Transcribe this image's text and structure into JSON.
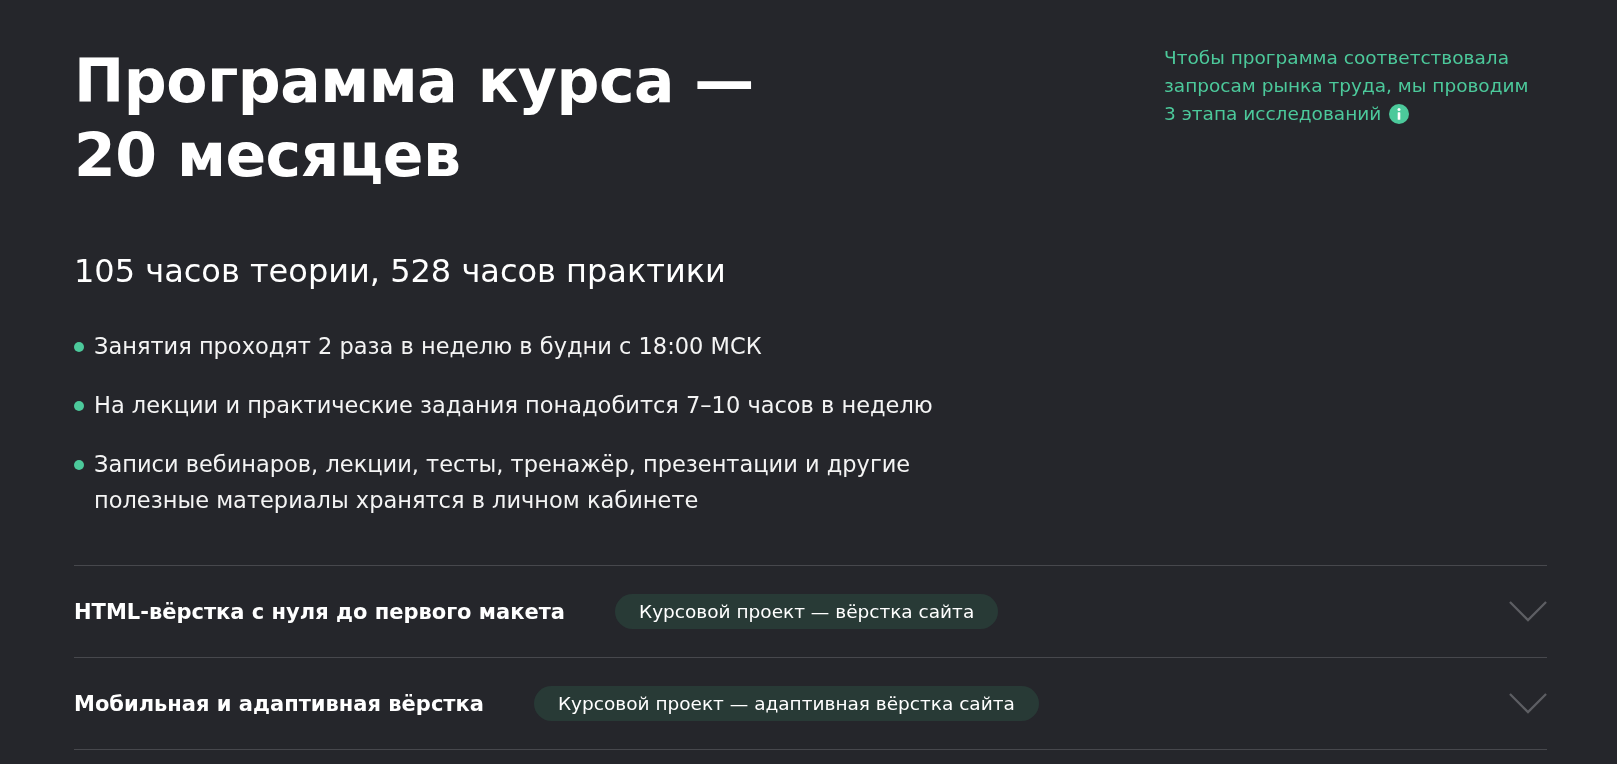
{
  "header": {
    "title": "Программа курса — 20 месяцев",
    "research_note": "Чтобы программа соответствовала запросам рынка труда, мы проводим 3 этапа исследований"
  },
  "summary": "105 часов теории, 528 часов практики",
  "facts": [
    "Занятия проходят 2 раза в неделю в будни с 18:00 МСК",
    "На лекции и практические задания понадобится 7–10 часов в неделю",
    "Записи вебинаров, лекции, тесты, тренажёр, презентации и другие полезные материалы хранятся в личном кабинете"
  ],
  "modules": [
    {
      "title": "HTML-вёрстка с нуля до первого макета",
      "badge": "Курсовой проект — вёрстка сайта",
      "expanded": false
    },
    {
      "title": "Мобильная и адаптивная вёрстка",
      "badge": "Курсовой проект — адаптивная вёрстка сайта",
      "expanded": false
    }
  ]
}
